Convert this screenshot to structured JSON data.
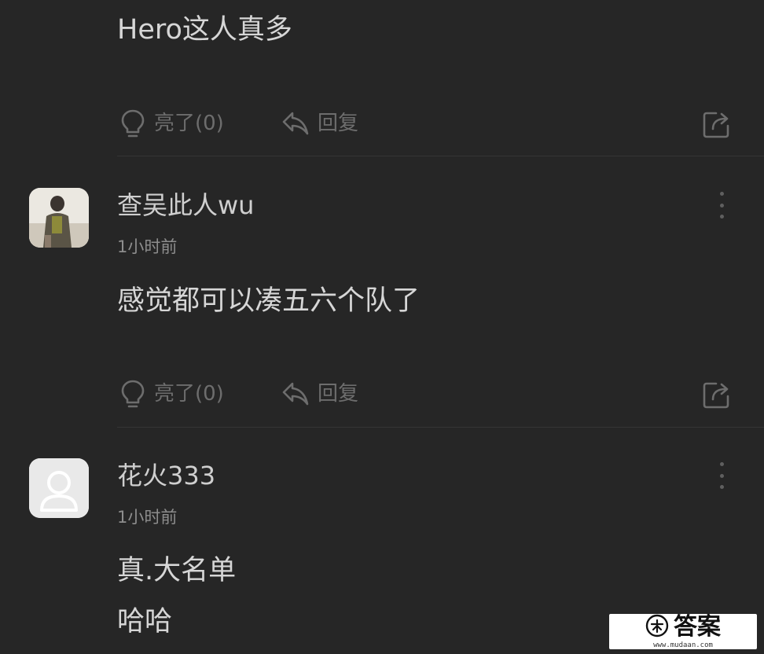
{
  "comments": [
    {
      "text": "Hero这人真多",
      "actions": {
        "like_label": "亮了(0)",
        "reply_label": "回复"
      }
    },
    {
      "username": "查吴此人wu",
      "timestamp": "1小时前",
      "text": "感觉都可以凑五六个队了",
      "actions": {
        "like_label": "亮了(0)",
        "reply_label": "回复"
      }
    },
    {
      "username": "花火333",
      "timestamp": "1小时前",
      "text_lines": [
        "真.大名单",
        "哈哈"
      ]
    }
  ],
  "icons": {
    "like": "lightbulb-icon",
    "reply": "reply-arrow-icon",
    "share": "share-icon",
    "more": "more-vertical-icon"
  },
  "watermark": {
    "brand": "答案",
    "url": "www.mudaan.com"
  }
}
